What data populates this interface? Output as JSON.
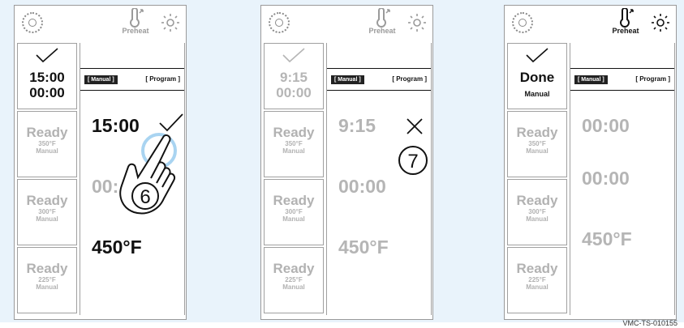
{
  "panels": [
    {
      "preheat_label": "Preheat",
      "tabs": {
        "manual": "[ Manual ]",
        "program": "[ Program ]"
      },
      "sidebar": {
        "active": {
          "line1": "15:00",
          "line2": "00:00"
        },
        "cards": [
          {
            "title": "Ready",
            "temp": "350°F",
            "mode": "Manual"
          },
          {
            "title": "Ready",
            "temp": "300°F",
            "mode": "Manual"
          },
          {
            "title": "Ready",
            "temp": "225°F",
            "mode": "Manual"
          }
        ]
      },
      "main": {
        "timer": "15:00",
        "time2": "00:",
        "temp": "450°F"
      },
      "step": "6"
    },
    {
      "preheat_label": "Preheat",
      "tabs": {
        "manual": "[ Manual ]",
        "program": "[ Program ]"
      },
      "sidebar": {
        "active": {
          "line1": "9:15",
          "line2": "00:00"
        },
        "cards": [
          {
            "title": "Ready",
            "temp": "350°F",
            "mode": "Manual"
          },
          {
            "title": "Ready",
            "temp": "300°F",
            "mode": "Manual"
          },
          {
            "title": "Ready",
            "temp": "225°F",
            "mode": "Manual"
          }
        ]
      },
      "main": {
        "timer": "9:15",
        "time2": "00:00",
        "temp": "450°F"
      },
      "step": "7"
    },
    {
      "preheat_label": "Preheat",
      "tabs": {
        "manual": "[ Manual ]",
        "program": "[ Program ]"
      },
      "sidebar": {
        "active": {
          "line1": "Done",
          "line2": "Manual"
        },
        "cards": [
          {
            "title": "Ready",
            "temp": "350°F",
            "mode": "Manual"
          },
          {
            "title": "Ready",
            "temp": "300°F",
            "mode": "Manual"
          },
          {
            "title": "Ready",
            "temp": "225°F",
            "mode": "Manual"
          }
        ]
      },
      "main": {
        "timer": "00:00",
        "time2": "00:00",
        "temp": "450°F"
      }
    }
  ],
  "footer_code": "VMC-TS-010155",
  "colors": {
    "background": "#e9f3fb",
    "touch_ring": "#a9d4f1"
  }
}
